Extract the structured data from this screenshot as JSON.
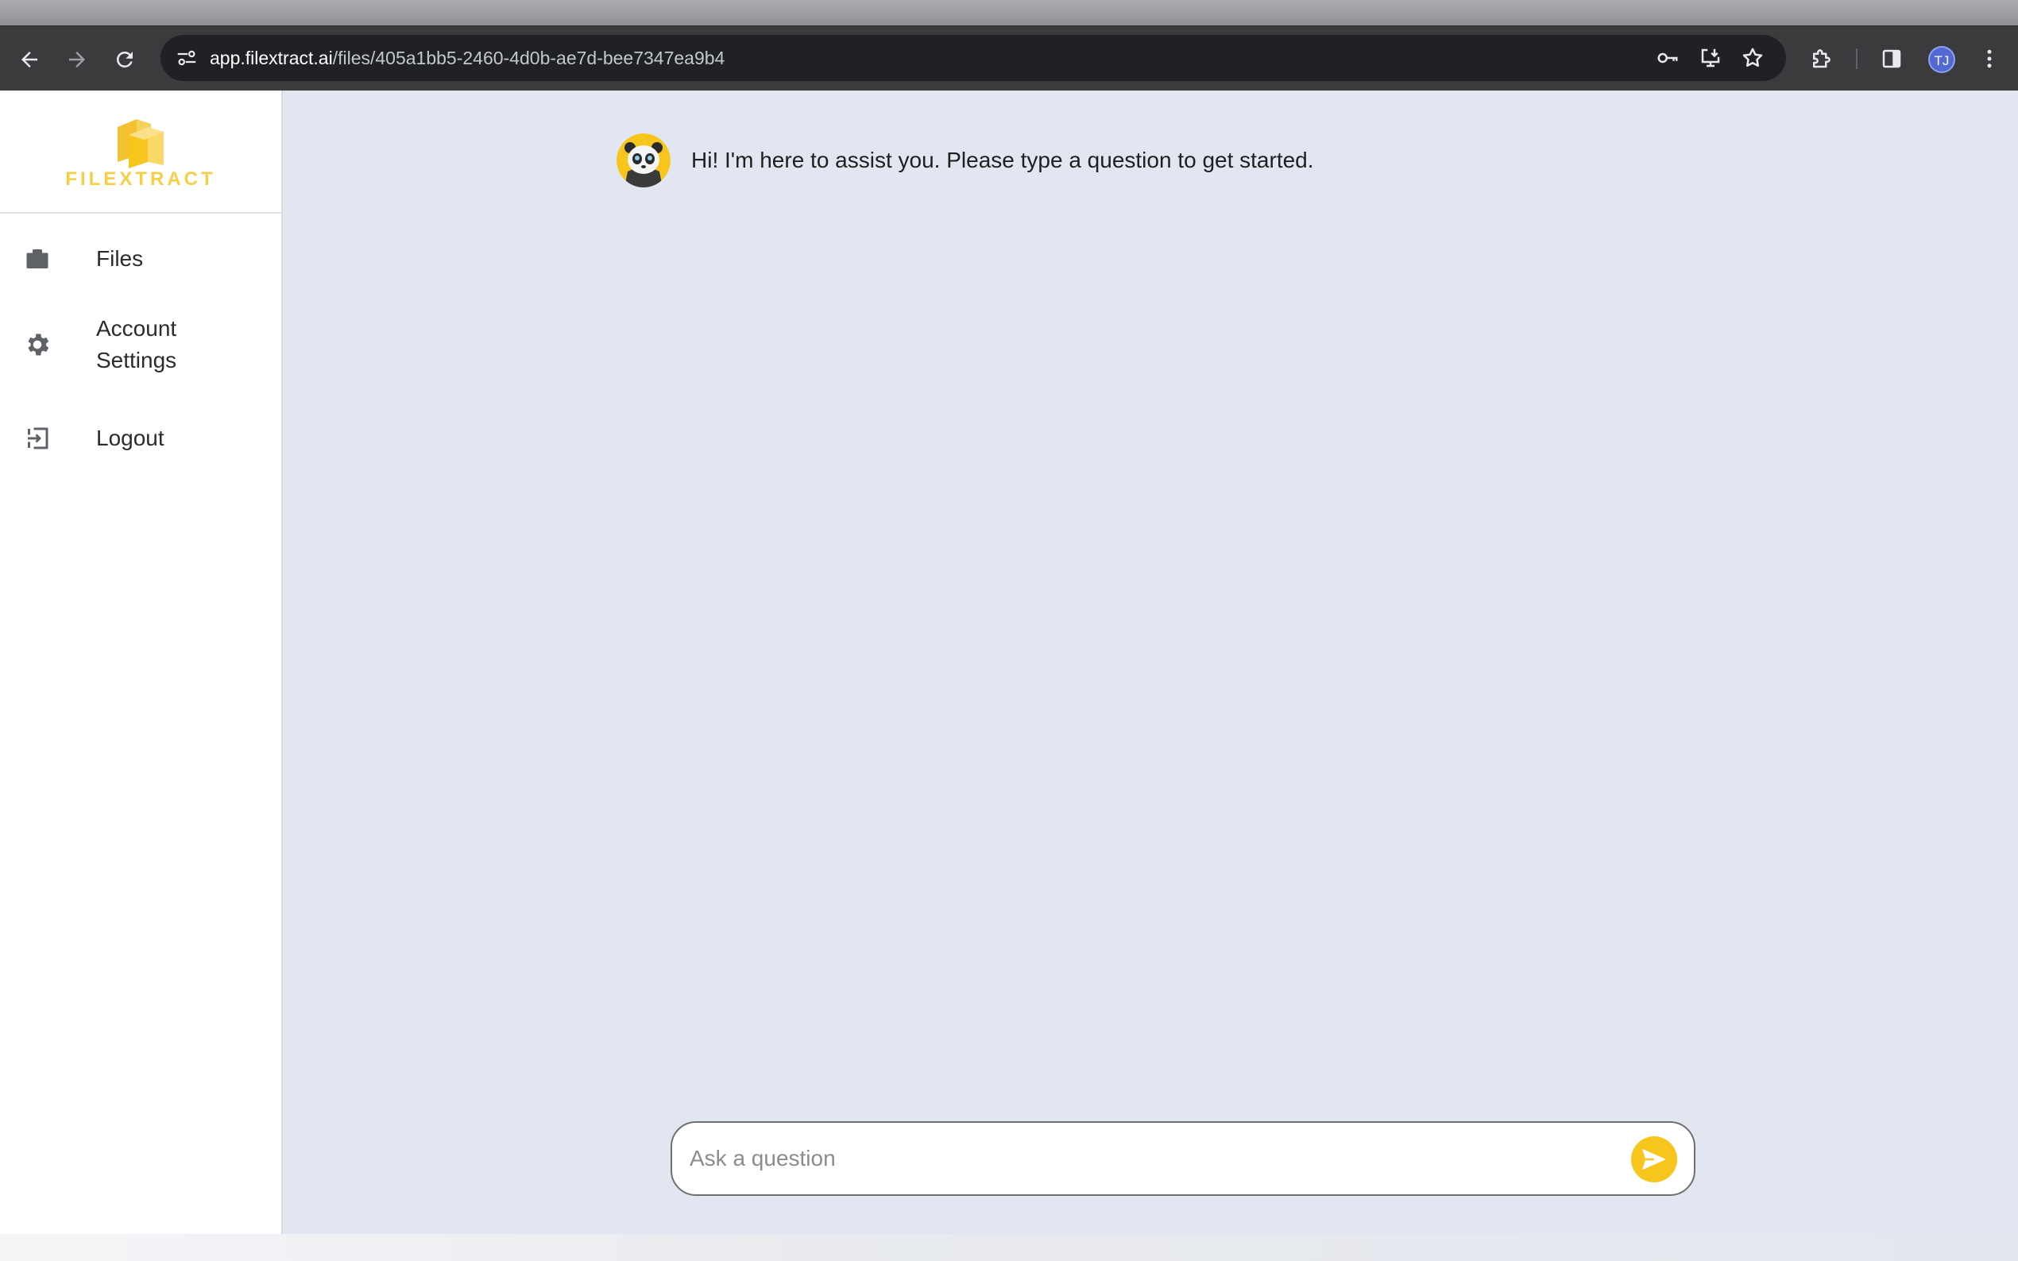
{
  "browser": {
    "url_domain": "app.filextract.ai",
    "url_path": "/files/405a1bb5-2460-4d0b-ae7d-bee7347ea9b4",
    "profile_initials": "TJ",
    "icons": {
      "back": "back-arrow-icon",
      "forward": "forward-arrow-icon",
      "reload": "reload-icon",
      "site_info": "tune-icon",
      "password": "key-icon",
      "install": "install-app-icon",
      "bookmark": "star-icon",
      "extensions": "puzzle-icon",
      "side_panel": "side-panel-icon",
      "menu": "more-vert-icon"
    }
  },
  "sidebar": {
    "logo_text": "FILEXTRACT",
    "items": [
      {
        "label": "Files",
        "icon": "briefcase-icon"
      },
      {
        "label_line1": "Account",
        "label_line2": "Settings",
        "icon": "gear-icon"
      },
      {
        "label": "Logout",
        "icon": "logout-icon"
      }
    ]
  },
  "chat": {
    "bot_message": "Hi! I'm here to assist you. Please type a question to get started.",
    "bot_avatar": "panda-avatar",
    "input_placeholder": "Ask a question",
    "input_value": ""
  },
  "colors": {
    "brand_yellow": "#f8c51c",
    "logo_yellow": "#f7cf47",
    "main_background": "#e1e6f1",
    "toolbar": "#3b3b3d",
    "omnibox": "#202124",
    "profile": "#5468d4"
  }
}
